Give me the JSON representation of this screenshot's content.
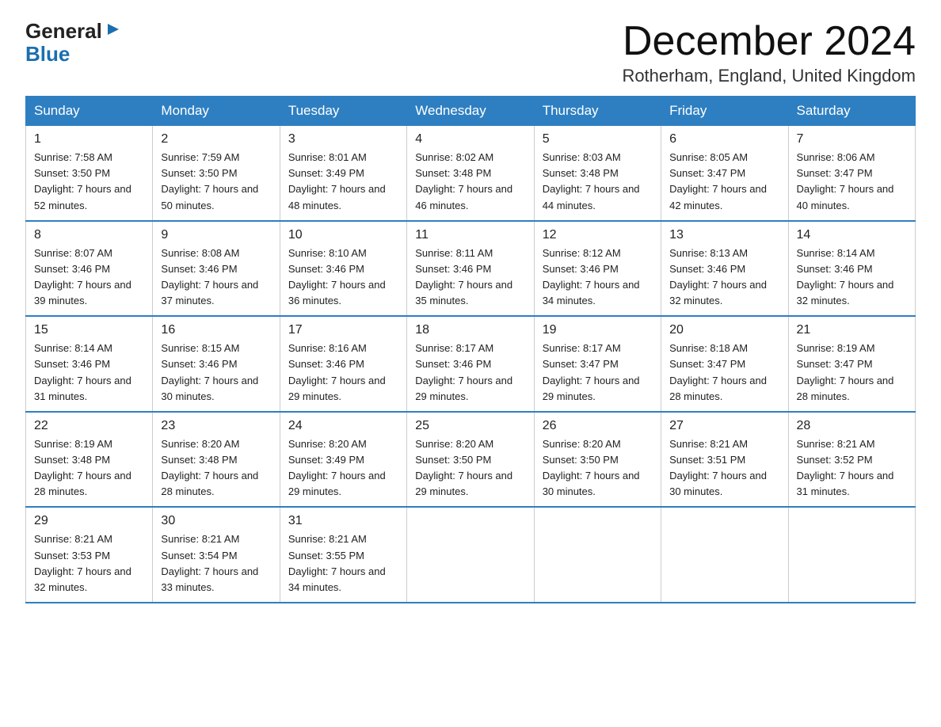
{
  "header": {
    "logo_general": "General",
    "logo_blue": "Blue",
    "month_title": "December 2024",
    "subtitle": "Rotherham, England, United Kingdom"
  },
  "weekdays": [
    "Sunday",
    "Monday",
    "Tuesday",
    "Wednesday",
    "Thursday",
    "Friday",
    "Saturday"
  ],
  "weeks": [
    [
      {
        "day": "1",
        "sunrise": "7:58 AM",
        "sunset": "3:50 PM",
        "daylight": "7 hours and 52 minutes."
      },
      {
        "day": "2",
        "sunrise": "7:59 AM",
        "sunset": "3:50 PM",
        "daylight": "7 hours and 50 minutes."
      },
      {
        "day": "3",
        "sunrise": "8:01 AM",
        "sunset": "3:49 PM",
        "daylight": "7 hours and 48 minutes."
      },
      {
        "day": "4",
        "sunrise": "8:02 AM",
        "sunset": "3:48 PM",
        "daylight": "7 hours and 46 minutes."
      },
      {
        "day": "5",
        "sunrise": "8:03 AM",
        "sunset": "3:48 PM",
        "daylight": "7 hours and 44 minutes."
      },
      {
        "day": "6",
        "sunrise": "8:05 AM",
        "sunset": "3:47 PM",
        "daylight": "7 hours and 42 minutes."
      },
      {
        "day": "7",
        "sunrise": "8:06 AM",
        "sunset": "3:47 PM",
        "daylight": "7 hours and 40 minutes."
      }
    ],
    [
      {
        "day": "8",
        "sunrise": "8:07 AM",
        "sunset": "3:46 PM",
        "daylight": "7 hours and 39 minutes."
      },
      {
        "day": "9",
        "sunrise": "8:08 AM",
        "sunset": "3:46 PM",
        "daylight": "7 hours and 37 minutes."
      },
      {
        "day": "10",
        "sunrise": "8:10 AM",
        "sunset": "3:46 PM",
        "daylight": "7 hours and 36 minutes."
      },
      {
        "day": "11",
        "sunrise": "8:11 AM",
        "sunset": "3:46 PM",
        "daylight": "7 hours and 35 minutes."
      },
      {
        "day": "12",
        "sunrise": "8:12 AM",
        "sunset": "3:46 PM",
        "daylight": "7 hours and 34 minutes."
      },
      {
        "day": "13",
        "sunrise": "8:13 AM",
        "sunset": "3:46 PM",
        "daylight": "7 hours and 32 minutes."
      },
      {
        "day": "14",
        "sunrise": "8:14 AM",
        "sunset": "3:46 PM",
        "daylight": "7 hours and 32 minutes."
      }
    ],
    [
      {
        "day": "15",
        "sunrise": "8:14 AM",
        "sunset": "3:46 PM",
        "daylight": "7 hours and 31 minutes."
      },
      {
        "day": "16",
        "sunrise": "8:15 AM",
        "sunset": "3:46 PM",
        "daylight": "7 hours and 30 minutes."
      },
      {
        "day": "17",
        "sunrise": "8:16 AM",
        "sunset": "3:46 PM",
        "daylight": "7 hours and 29 minutes."
      },
      {
        "day": "18",
        "sunrise": "8:17 AM",
        "sunset": "3:46 PM",
        "daylight": "7 hours and 29 minutes."
      },
      {
        "day": "19",
        "sunrise": "8:17 AM",
        "sunset": "3:47 PM",
        "daylight": "7 hours and 29 minutes."
      },
      {
        "day": "20",
        "sunrise": "8:18 AM",
        "sunset": "3:47 PM",
        "daylight": "7 hours and 28 minutes."
      },
      {
        "day": "21",
        "sunrise": "8:19 AM",
        "sunset": "3:47 PM",
        "daylight": "7 hours and 28 minutes."
      }
    ],
    [
      {
        "day": "22",
        "sunrise": "8:19 AM",
        "sunset": "3:48 PM",
        "daylight": "7 hours and 28 minutes."
      },
      {
        "day": "23",
        "sunrise": "8:20 AM",
        "sunset": "3:48 PM",
        "daylight": "7 hours and 28 minutes."
      },
      {
        "day": "24",
        "sunrise": "8:20 AM",
        "sunset": "3:49 PM",
        "daylight": "7 hours and 29 minutes."
      },
      {
        "day": "25",
        "sunrise": "8:20 AM",
        "sunset": "3:50 PM",
        "daylight": "7 hours and 29 minutes."
      },
      {
        "day": "26",
        "sunrise": "8:20 AM",
        "sunset": "3:50 PM",
        "daylight": "7 hours and 30 minutes."
      },
      {
        "day": "27",
        "sunrise": "8:21 AM",
        "sunset": "3:51 PM",
        "daylight": "7 hours and 30 minutes."
      },
      {
        "day": "28",
        "sunrise": "8:21 AM",
        "sunset": "3:52 PM",
        "daylight": "7 hours and 31 minutes."
      }
    ],
    [
      {
        "day": "29",
        "sunrise": "8:21 AM",
        "sunset": "3:53 PM",
        "daylight": "7 hours and 32 minutes."
      },
      {
        "day": "30",
        "sunrise": "8:21 AM",
        "sunset": "3:54 PM",
        "daylight": "7 hours and 33 minutes."
      },
      {
        "day": "31",
        "sunrise": "8:21 AM",
        "sunset": "3:55 PM",
        "daylight": "7 hours and 34 minutes."
      },
      null,
      null,
      null,
      null
    ]
  ]
}
